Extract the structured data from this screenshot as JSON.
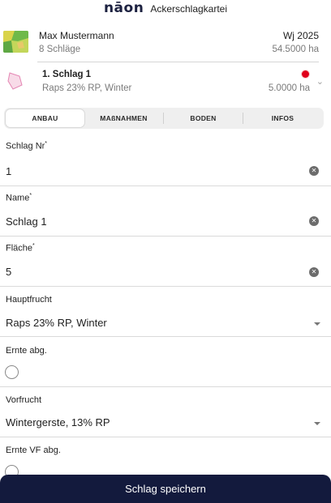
{
  "header": {
    "logo_text": "nāon",
    "title": "Ackerschlagkartei"
  },
  "farm": {
    "name": "Max Mustermann",
    "field_count": "8 Schläge",
    "year": "Wj 2025",
    "total_area": "54.5000 ha"
  },
  "field": {
    "name": "1. Schlag 1",
    "crop": "Raps 23% RP, Winter",
    "area": "5.0000 ha",
    "status_color": "#e0001b"
  },
  "tabs": [
    {
      "label": "ANBAU",
      "active": true
    },
    {
      "label": "MAßNAHMEN",
      "active": false
    },
    {
      "label": "BODEN",
      "active": false
    },
    {
      "label": "INFOS",
      "active": false
    }
  ],
  "form": {
    "schlag_nr": {
      "label": "Schlag Nr",
      "required_mark": "*",
      "value": "1"
    },
    "name": {
      "label": "Name",
      "required_mark": "*",
      "value": "Schlag 1"
    },
    "flaeche": {
      "label": "Fläche",
      "required_mark": "*",
      "value": "5"
    },
    "hauptfrucht": {
      "label": "Hauptfrucht",
      "value": "Raps 23% RP, Winter"
    },
    "ernte_abg": {
      "label": "Ernte abg.",
      "checked": false
    },
    "vorfrucht": {
      "label": "Vorfrucht",
      "value": "Wintergerste, 13% RP"
    },
    "ernte_vf_abg": {
      "label": "Ernte VF abg.",
      "checked": false
    }
  },
  "actions": {
    "save_label": "Schlag speichern"
  },
  "icons": {
    "clear": "clear-circle-icon",
    "dropdown": "caret-down-icon",
    "field_expand": "chevron-down-icon"
  },
  "colors": {
    "primary_dark": "#131a3d",
    "status_red": "#e0001b",
    "muted_text": "#7a7a7a"
  }
}
